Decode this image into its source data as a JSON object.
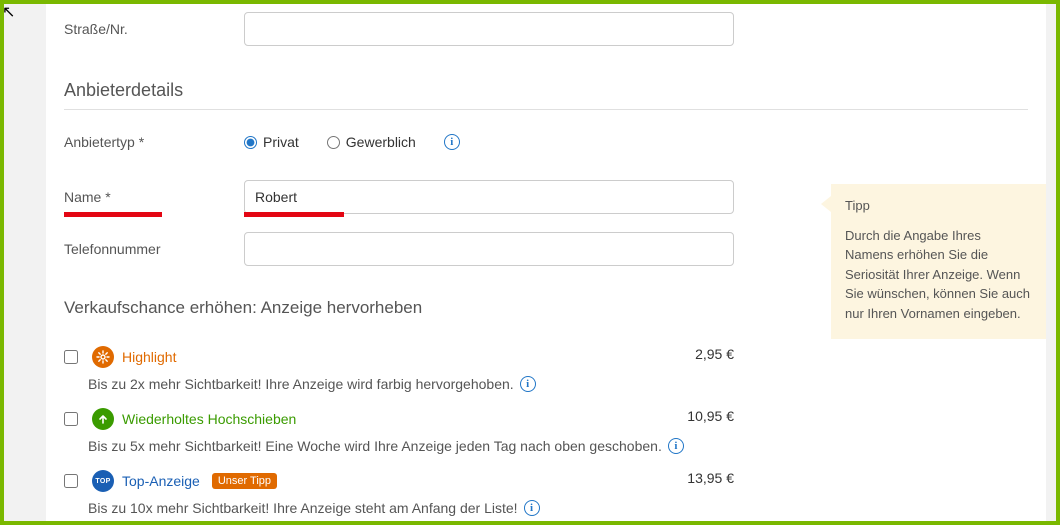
{
  "address": {
    "street_label": "Straße/Nr.",
    "street_value": ""
  },
  "provider": {
    "heading": "Anbieterdetails",
    "type_label": "Anbietertyp *",
    "option_private": "Privat",
    "option_commercial": "Gewerblich",
    "name_label": "Name *",
    "name_value": "Robert",
    "phone_label": "Telefonnummer",
    "phone_value": ""
  },
  "tip": {
    "title": "Tipp",
    "body": "Durch die Angabe Ihres Namens erhöhen Sie die Seriosität Ihrer Anzeige. Wenn Sie wünschen, können Sie auch nur Ihren Vornamen eingeben."
  },
  "boost": {
    "heading": "Verkaufschance erhöhen: Anzeige hervorheben",
    "items": [
      {
        "title": "Highlight",
        "desc": "Bis zu 2x mehr Sichtbarkeit! Ihre Anzeige wird farbig hervorgehoben.",
        "price": "2,95 €",
        "badge": ""
      },
      {
        "title": "Wiederholtes Hochschieben",
        "desc": "Bis zu 5x mehr Sichtbarkeit! Eine Woche wird Ihre Anzeige jeden Tag nach oben geschoben.",
        "price": "10,95 €",
        "badge": ""
      },
      {
        "title": "Top-Anzeige",
        "desc": "Bis zu 10x mehr Sichtbarkeit! Ihre Anzeige steht am Anfang der Liste!",
        "price": "13,95 €",
        "badge": "Unser Tipp"
      }
    ]
  }
}
